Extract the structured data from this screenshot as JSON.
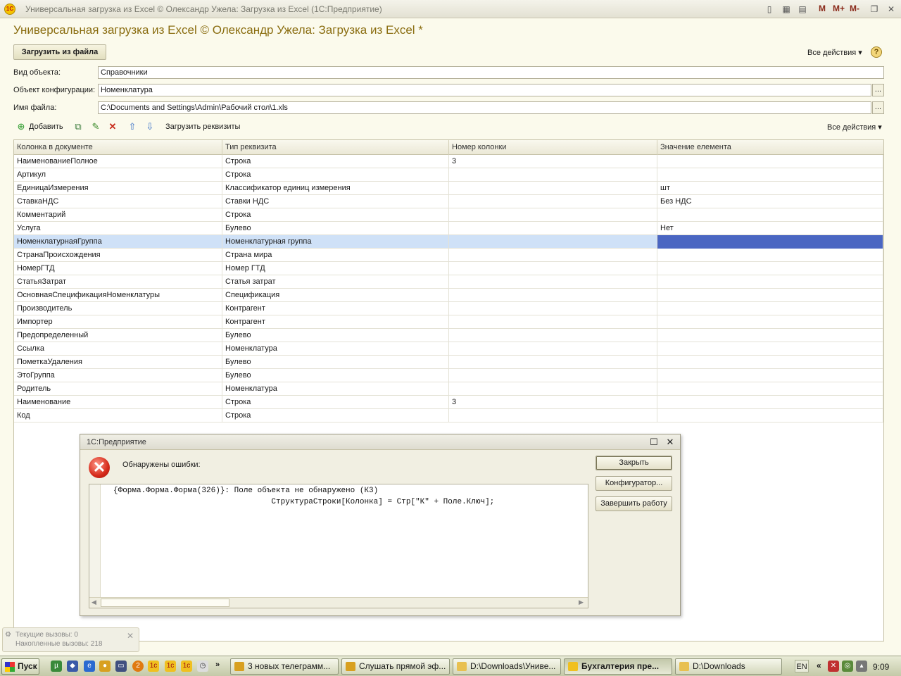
{
  "window": {
    "title": "Универсальная загрузка из Excel © Олександр Ужела: Загрузка из Excel  (1С:Предприятие)",
    "title_buttons": [
      "M",
      "M+",
      "M-"
    ]
  },
  "form": {
    "title": "Универсальная загрузка из Excel © Олександр Ужела: Загрузка из Excel *",
    "load_button": "Загрузить из файла",
    "all_actions": "Все действия",
    "help": "?"
  },
  "fields": {
    "object_type": {
      "label": "Вид объекта:",
      "value": "Справочники"
    },
    "config_object": {
      "label": "Объект конфигурации:",
      "value": "Номенклатура"
    },
    "file_name": {
      "label": "Имя файла:",
      "value": "C:\\Documents and Settings\\Admin\\Рабочий стол\\1.xls"
    },
    "select_button": "..."
  },
  "toolbar": {
    "add": "Добавить",
    "load_requisites": "Загрузить реквизиты",
    "all_actions": "Все действия"
  },
  "table": {
    "columns": [
      "Колонка в документе",
      "Тип реквизита",
      "Номер колонки",
      "Значение елемента"
    ],
    "rows": [
      [
        "НаименованиеПолное",
        "Строка",
        "3",
        ""
      ],
      [
        "Артикул",
        "Строка",
        "",
        ""
      ],
      [
        "ЕдиницаИзмерения",
        "Классификатор единиц измерения",
        "",
        "шт"
      ],
      [
        "СтавкаНДС",
        "Ставки НДС",
        "",
        "Без НДС"
      ],
      [
        "Комментарий",
        "Строка",
        "",
        ""
      ],
      [
        "Услуга",
        "Булево",
        "",
        "Нет"
      ],
      [
        "НоменклатурнаяГруппа",
        "Номенклатурная группа",
        "",
        ""
      ],
      [
        "СтранаПроисхождения",
        "Страна мира",
        "",
        ""
      ],
      [
        "НомерГТД",
        "Номер ГТД",
        "",
        ""
      ],
      [
        "СтатьяЗатрат",
        "Статья затрат",
        "",
        ""
      ],
      [
        "ОсновнаяСпецификацияНоменклатуры",
        "Спецификация",
        "",
        ""
      ],
      [
        "Производитель",
        "Контрагент",
        "",
        ""
      ],
      [
        "Импортер",
        "Контрагент",
        "",
        ""
      ],
      [
        "Предопределенный",
        "Булево",
        "",
        ""
      ],
      [
        "Ссылка",
        "Номенклатура",
        "",
        ""
      ],
      [
        "ПометкаУдаления",
        "Булево",
        "",
        ""
      ],
      [
        "ЭтоГруппа",
        "Булево",
        "",
        ""
      ],
      [
        "Родитель",
        "Номенклатура",
        "",
        ""
      ],
      [
        "Наименование",
        "Строка",
        "3",
        ""
      ],
      [
        "Код",
        "Строка",
        "",
        ""
      ]
    ],
    "selected_row": 6
  },
  "dialog": {
    "title": "1С:Предприятие",
    "message": "Обнаружены ошибки:",
    "error_line1": "{Форма.Форма.Форма(326)}: Поле объекта не обнаружено (К3)",
    "error_line2": "                                  СтруктураСтроки[Колонка] = Стр[\"К\" + Поле.Ключ];",
    "close": "Закрыть",
    "configurator": "Конфигуратор...",
    "exit": "Завершить работу"
  },
  "status": {
    "current_calls": "Текущие вызовы: 0",
    "accumulated_calls": "Накопленные вызовы: 218"
  },
  "taskbar": {
    "start": "Пуск",
    "tasks": [
      "3 новых телеграмм...",
      "Слушать прямой эф...",
      "D:\\Downloads\\Униве...",
      "Бухгалтерия пре...",
      "D:\\Downloads"
    ],
    "active_task": 3,
    "lang": "EN",
    "clock": "9:09"
  },
  "colors": {
    "accent": "#8a6d10",
    "selected_row": "#cfe1f7",
    "active_cell": "#4a66c2"
  }
}
